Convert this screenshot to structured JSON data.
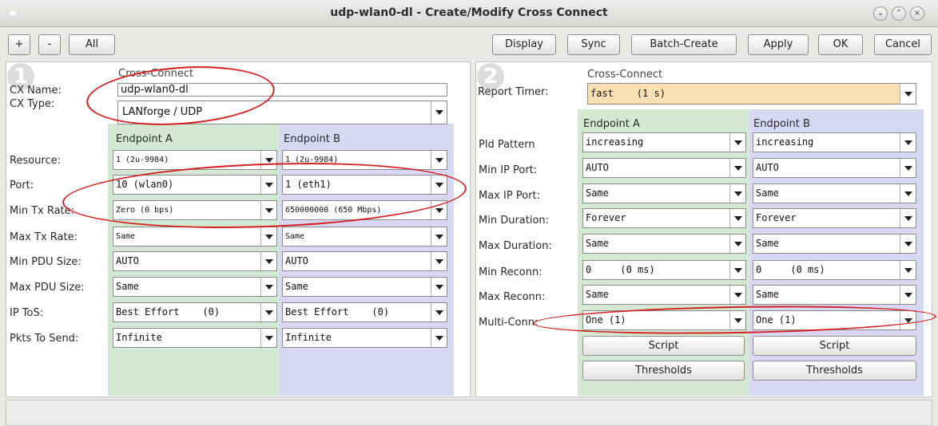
{
  "window": {
    "title": "udp-wlan0-dl - Create/Modify Cross Connect",
    "controls": [
      "⌄",
      "⌃",
      "×"
    ]
  },
  "toolbar": {
    "plus_label": "+",
    "minus_label": "-",
    "all_label": "All",
    "display_label": "Display",
    "sync_label": "Sync",
    "batch_create_label": "Batch-Create",
    "apply_label": "Apply",
    "ok_label": "OK",
    "cancel_label": "Cancel"
  },
  "left": {
    "badge": "1",
    "section_title": "Cross-Connect",
    "cx_name_label": "CX Name:",
    "cx_name_value": "udp-wlan0-dl",
    "cx_type_label": "CX Type:",
    "cx_type_value": "LANforge / UDP",
    "endpoint_a": "Endpoint A",
    "endpoint_b": "Endpoint B",
    "rows": [
      {
        "label": "Resource:",
        "a": "1 (2u-9984)",
        "b": "1 (2u-9984)"
      },
      {
        "label": "Port:",
        "a": "10 (wlan0)",
        "b": "1 (eth1)"
      },
      {
        "label": "Min Tx Rate:",
        "a": "Zero (0 bps)",
        "b": "650000000 (650 Mbps)"
      },
      {
        "label": "Max Tx Rate:",
        "a": "Same",
        "b": "Same"
      },
      {
        "label": "Min PDU Size:",
        "a": "AUTO",
        "b": "AUTO"
      },
      {
        "label": "Max PDU Size:",
        "a": "Same",
        "b": "Same"
      },
      {
        "label": "IP ToS:",
        "a": "Best Effort    (0)",
        "b": "Best Effort    (0)"
      },
      {
        "label": "Pkts To Send:",
        "a": "Infinite",
        "b": "Infinite"
      }
    ]
  },
  "right": {
    "badge": "2",
    "section_title": "Cross-Connect",
    "report_timer_label": "Report Timer:",
    "report_timer_value": "fast    (1 s)",
    "report_timer_color": "#fbe0b6",
    "endpoint_a": "Endpoint A",
    "endpoint_b": "Endpoint B",
    "rows": [
      {
        "label": "Pld Pattern",
        "a": "increasing",
        "b": "increasing"
      },
      {
        "label": "Min IP Port:",
        "a": "AUTO",
        "b": "AUTO"
      },
      {
        "label": "Max IP Port:",
        "a": "Same",
        "b": "Same"
      },
      {
        "label": "Min Duration:",
        "a": "Forever",
        "b": "Forever"
      },
      {
        "label": "Max Duration:",
        "a": "Same",
        "b": "Same"
      },
      {
        "label": "Min Reconn:",
        "a": "0     (0 ms)",
        "b": "0     (0 ms)"
      },
      {
        "label": "Max Reconn:",
        "a": "Same",
        "b": "Same"
      },
      {
        "label": "Multi-Conn:",
        "a": "One (1)",
        "b": "One (1)"
      }
    ],
    "script_label": "Script",
    "thresholds_label": "Thresholds"
  },
  "colors": {
    "endpoint_a_bg": "#d3e9d1",
    "endpoint_b_bg": "#d8d8f2",
    "annotation": "#d42020"
  }
}
